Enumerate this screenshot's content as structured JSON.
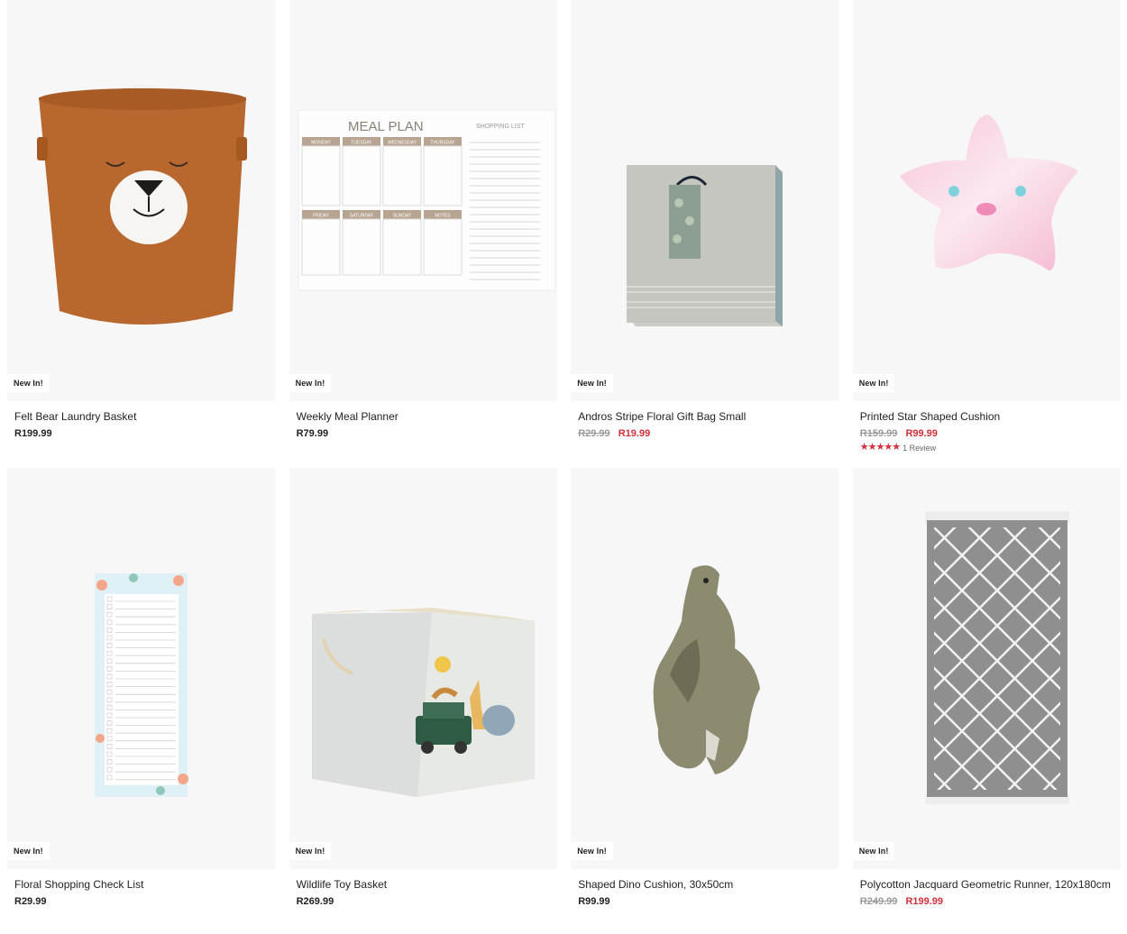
{
  "products": [
    {
      "badge": "New In!",
      "title": "Felt Bear Laundry Basket",
      "price": "R199.99"
    },
    {
      "badge": "New In!",
      "title": "Weekly Meal Planner",
      "price": "R79.99",
      "planner": {
        "heading": "MEAL PLAN",
        "shopping": "SHOPPING LIST",
        "days_top": [
          "MONDAY",
          "TUESDAY",
          "WEDNESDAY",
          "THURSDAY"
        ],
        "days_bottom": [
          "FRIDAY",
          "SATURDAY",
          "SUNDAY",
          "NOTES"
        ]
      }
    },
    {
      "badge": "New In!",
      "title": "Andros Stripe Floral Gift Bag Small",
      "old_price": "R29.99",
      "sale_price": "R19.99"
    },
    {
      "badge": "New In!",
      "title": "Printed Star Shaped Cushion",
      "old_price": "R159.99",
      "sale_price": "R99.99",
      "rating": {
        "stars": "★★★★★",
        "value": 5,
        "reviews": "1 Review"
      }
    },
    {
      "badge": "New In!",
      "title": "Floral Shopping Check List",
      "price": "R29.99"
    },
    {
      "badge": "New In!",
      "title": "Wildlife Toy Basket",
      "price": "R269.99"
    },
    {
      "badge": "New In!",
      "title": "Shaped Dino Cushion, 30x50cm",
      "price": "R99.99"
    },
    {
      "badge": "New In!",
      "title": "Polycotton Jacquard Geometric Runner, 120x180cm",
      "old_price": "R249.99",
      "sale_price": "R199.99"
    }
  ],
  "colors": {
    "sale": "#d32f3a",
    "old_price": "#9a9a9a",
    "tile_bg": "#f7f7f7"
  }
}
